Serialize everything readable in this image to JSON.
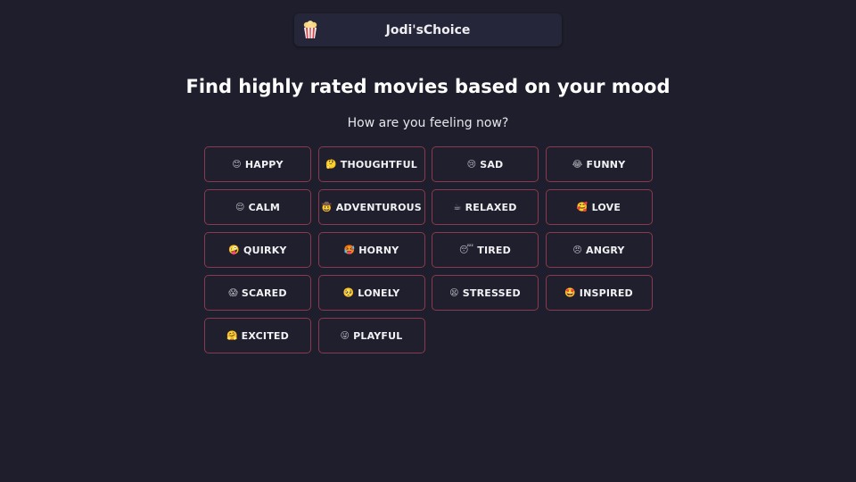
{
  "header": {
    "logo_icon": "popcorn-icon",
    "app_title": "Jodi'sChoice"
  },
  "main": {
    "title": "Find highly rated movies based on your mood",
    "subtitle": "How are you feeling now?",
    "moods": [
      {
        "emoji": "😊",
        "label": "HAPPY"
      },
      {
        "emoji": "🤔",
        "label": "THOUGHTFUL"
      },
      {
        "emoji": "😢",
        "label": "SAD"
      },
      {
        "emoji": "😂",
        "label": "FUNNY"
      },
      {
        "emoji": "😌",
        "label": "CALM"
      },
      {
        "emoji": "🤠",
        "label": "ADVENTUROUS"
      },
      {
        "emoji": "☕",
        "label": "RELAXED"
      },
      {
        "emoji": "🥰",
        "label": "LOVE"
      },
      {
        "emoji": "🤪",
        "label": "QUIRKY"
      },
      {
        "emoji": "🥵",
        "label": "HORNY"
      },
      {
        "emoji": "😴",
        "label": "TIRED"
      },
      {
        "emoji": "😠",
        "label": "ANGRY"
      },
      {
        "emoji": "😱",
        "label": "SCARED"
      },
      {
        "emoji": "🥺",
        "label": "LONELY"
      },
      {
        "emoji": "😫",
        "label": "STRESSED"
      },
      {
        "emoji": "🤩",
        "label": "INSPIRED"
      },
      {
        "emoji": "🤗",
        "label": "EXCITED"
      },
      {
        "emoji": "😜",
        "label": "PLAYFUL"
      }
    ]
  },
  "colors": {
    "background": "#1e1e2c",
    "header_bg": "#252639",
    "button_border": "#8a3a4f"
  }
}
